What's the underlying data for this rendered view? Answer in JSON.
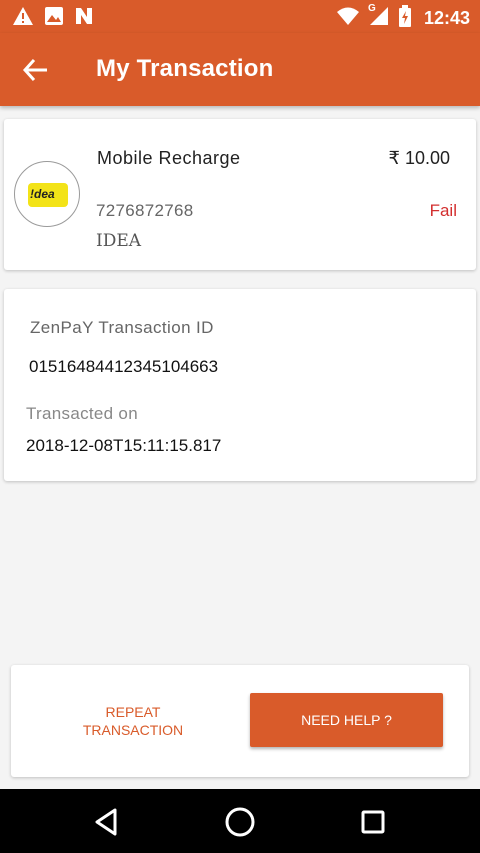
{
  "status_bar": {
    "time": "12:43",
    "network_label": "G",
    "icons": [
      "warning-icon",
      "image-icon",
      "n-logo-icon",
      "wifi-icon",
      "signal-icon",
      "battery-icon"
    ]
  },
  "app_bar": {
    "title": "My Transaction",
    "back_icon": "arrow-left-icon"
  },
  "transaction": {
    "service": "Mobile Recharge",
    "amount": "₹ 10.00",
    "mobile_number": "7276872768",
    "operator": "IDEA",
    "status": "Fail",
    "logo_text": "!dea",
    "status_color": "#d32f2f"
  },
  "details": {
    "id_label": "ZenPaY Transaction ID",
    "id_value": "01516484412345104663",
    "date_label": "Transacted on",
    "date_value": "2018-12-08T15:11:15.817"
  },
  "actions": {
    "repeat_line1": "REPEAT",
    "repeat_line2": "TRANSACTION",
    "help_label": "NEED HELP ?"
  },
  "nav": {
    "icons": [
      "back-triangle-icon",
      "home-circle-icon",
      "recents-square-icon"
    ]
  },
  "colors": {
    "accent": "#d95b2a",
    "fail": "#d32f2f",
    "idea_yellow": "#f3e318"
  }
}
